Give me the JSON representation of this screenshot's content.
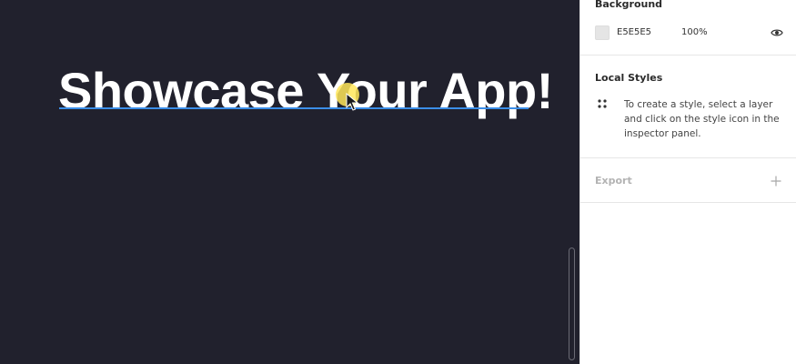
{
  "canvas": {
    "headline": "Showcase Your App!",
    "background_color": "#21212d",
    "text_color": "#ffffff",
    "selection_underline_color": "#3b8ee8",
    "cursor_highlight_color": "#ffe65a"
  },
  "inspector": {
    "background": {
      "title": "Background",
      "swatch_color": "#E5E5E5",
      "hex": "E5E5E5",
      "opacity": "100%",
      "visibility_icon": "eye-icon"
    },
    "local_styles": {
      "title": "Local Styles",
      "icon": "style-dots-icon",
      "help_text": "To create a style, select a layer and click on the style icon in the inspector panel."
    },
    "export": {
      "title": "Export",
      "add_icon": "plus-icon"
    }
  }
}
